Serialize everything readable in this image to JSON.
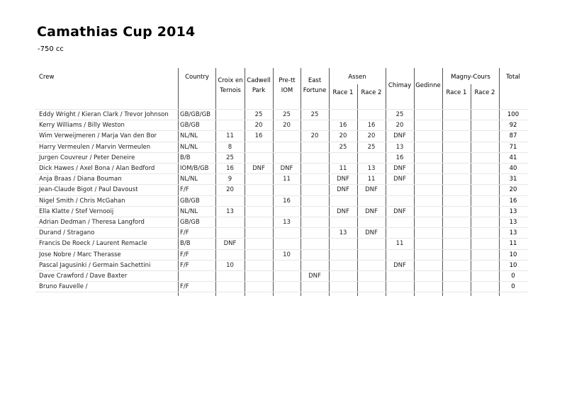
{
  "document": {
    "title": "Camathias Cup 2014",
    "subtitle": "-750 cc"
  },
  "table": {
    "headers": {
      "crew": "Crew",
      "country": "Country",
      "croix_en_ternois_1": "Croix en",
      "croix_en_ternois_2": "Ternois",
      "cadwell_park_1": "Cadwell",
      "cadwell_park_2": "Park",
      "pre_tt_iom_1": "Pre-tt",
      "pre_tt_iom_2": "IOM",
      "east_fortune_1": "East",
      "east_fortune_2": "Fortune",
      "assen": "Assen",
      "assen_race1": "Race 1",
      "assen_race2": "Race 2",
      "chimay": "Chimay",
      "gedinne": "Gedinne",
      "magny_cours": "Magny-Cours",
      "magny_race1": "Race 1",
      "magny_race2": "Race 2",
      "total": "Total"
    },
    "columns": [
      "croix",
      "cadwell",
      "prett",
      "east",
      "assen1",
      "assen2",
      "chimay",
      "gedinne",
      "magny1",
      "magny2"
    ],
    "rows": [
      {
        "crew": "Eddy Wright / Kieran Clark / Trevor Johnson",
        "country": "GB/GB/GB",
        "croix": "",
        "cadwell": "25",
        "prett": "25",
        "east": "25",
        "assen1": "",
        "assen2": "",
        "chimay": "25",
        "gedinne": "",
        "magny1": "",
        "magny2": "",
        "total": "100"
      },
      {
        "crew": "Kerry Williams / Billy Weston",
        "country": "GB/GB",
        "croix": "",
        "cadwell": "20",
        "prett": "20",
        "east": "",
        "assen1": "16",
        "assen2": "16",
        "chimay": "20",
        "gedinne": "",
        "magny1": "",
        "magny2": "",
        "total": "92"
      },
      {
        "crew": "Wim Verweijmeren / Marja Van den Bor",
        "country": "NL/NL",
        "croix": "11",
        "cadwell": "16",
        "prett": "",
        "east": "20",
        "assen1": "20",
        "assen2": "20",
        "chimay": "DNF",
        "gedinne": "",
        "magny1": "",
        "magny2": "",
        "total": "87"
      },
      {
        "crew": "Harry Vermeulen / Marvin Vermeulen",
        "country": "NL/NL",
        "croix": "8",
        "cadwell": "",
        "prett": "",
        "east": "",
        "assen1": "25",
        "assen2": "25",
        "chimay": "13",
        "gedinne": "",
        "magny1": "",
        "magny2": "",
        "total": "71"
      },
      {
        "crew": "Jurgen Couvreur / Peter Deneire",
        "country": "B/B",
        "croix": "25",
        "cadwell": "",
        "prett": "",
        "east": "",
        "assen1": "",
        "assen2": "",
        "chimay": "16",
        "gedinne": "",
        "magny1": "",
        "magny2": "",
        "total": "41"
      },
      {
        "crew": "Dick Hawes / Axel Bona / Alan Bedford",
        "country": "IOM/B/GB",
        "croix": "16",
        "cadwell": "DNF",
        "prett": "DNF",
        "east": "",
        "assen1": "11",
        "assen2": "13",
        "chimay": "DNF",
        "gedinne": "",
        "magny1": "",
        "magny2": "",
        "total": "40"
      },
      {
        "crew": "Anja Braas / Diana Bouman",
        "country": "NL/NL",
        "croix": "9",
        "cadwell": "",
        "prett": "11",
        "east": "",
        "assen1": "DNF",
        "assen2": "11",
        "chimay": "DNF",
        "gedinne": "",
        "magny1": "",
        "magny2": "",
        "total": "31"
      },
      {
        "crew": "Jean-Claude Bigot / Paul Davoust",
        "country": "F/F",
        "croix": "20",
        "cadwell": "",
        "prett": "",
        "east": "",
        "assen1": "DNF",
        "assen2": "DNF",
        "chimay": "",
        "gedinne": "",
        "magny1": "",
        "magny2": "",
        "total": "20"
      },
      {
        "crew": "Nigel Smith / Chris McGahan",
        "country": "GB/GB",
        "croix": "",
        "cadwell": "",
        "prett": "16",
        "east": "",
        "assen1": "",
        "assen2": "",
        "chimay": "",
        "gedinne": "",
        "magny1": "",
        "magny2": "",
        "total": "16"
      },
      {
        "crew": "Ella Klatte / Stef Vernooij",
        "country": "NL/NL",
        "croix": "13",
        "cadwell": "",
        "prett": "",
        "east": "",
        "assen1": "DNF",
        "assen2": "DNF",
        "chimay": "DNF",
        "gedinne": "",
        "magny1": "",
        "magny2": "",
        "total": "13"
      },
      {
        "crew": "Adrian Dedman / Theresa Langford",
        "country": "GB/GB",
        "croix": "",
        "cadwell": "",
        "prett": "13",
        "east": "",
        "assen1": "",
        "assen2": "",
        "chimay": "",
        "gedinne": "",
        "magny1": "",
        "magny2": "",
        "total": "13"
      },
      {
        "crew": "Durand / Stragano",
        "country": "F/F",
        "croix": "",
        "cadwell": "",
        "prett": "",
        "east": "",
        "assen1": "13",
        "assen2": "DNF",
        "chimay": "",
        "gedinne": "",
        "magny1": "",
        "magny2": "",
        "total": "13"
      },
      {
        "crew": "Francis De Roeck / Laurent Remacle",
        "country": "B/B",
        "croix": "DNF",
        "cadwell": "",
        "prett": "",
        "east": "",
        "assen1": "",
        "assen2": "",
        "chimay": "11",
        "gedinne": "",
        "magny1": "",
        "magny2": "",
        "total": "11"
      },
      {
        "crew": "Jose Nobre / Marc Therasse",
        "country": "F/F",
        "croix": "",
        "cadwell": "",
        "prett": "10",
        "east": "",
        "assen1": "",
        "assen2": "",
        "chimay": "",
        "gedinne": "",
        "magny1": "",
        "magny2": "",
        "total": "10"
      },
      {
        "crew": "Pascal Jagusinki / Germain Sachettini",
        "country": "F/F",
        "croix": "10",
        "cadwell": "",
        "prett": "",
        "east": "",
        "assen1": "",
        "assen2": "",
        "chimay": "DNF",
        "gedinne": "",
        "magny1": "",
        "magny2": "",
        "total": "10"
      },
      {
        "crew": "Dave Crawford / Dave Baxter",
        "country": "",
        "croix": "",
        "cadwell": "",
        "prett": "",
        "east": "DNF",
        "assen1": "",
        "assen2": "",
        "chimay": "",
        "gedinne": "",
        "magny1": "",
        "magny2": "",
        "total": "0"
      },
      {
        "crew": "Bruno Fauvelle /",
        "country": "F/F",
        "croix": "",
        "cadwell": "",
        "prett": "",
        "east": "",
        "assen1": "",
        "assen2": "",
        "chimay": "",
        "gedinne": "",
        "magny1": "",
        "magny2": "",
        "total": "0"
      }
    ]
  }
}
